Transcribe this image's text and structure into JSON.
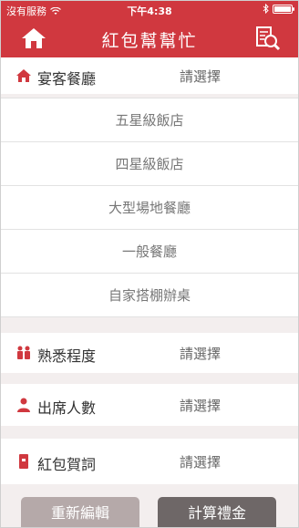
{
  "status": {
    "carrier": "沒有服務",
    "time": "下午4:38"
  },
  "nav": {
    "title": "紅包幫幫忙"
  },
  "venue": {
    "label": "宴客餐廳",
    "value": "請選擇",
    "options": [
      "五星級飯店",
      "四星級飯店",
      "大型場地餐廳",
      "一般餐廳",
      "自家搭棚辦桌"
    ]
  },
  "familiarity": {
    "label": "熟悉程度",
    "value": "請選擇"
  },
  "attendees": {
    "label": "出席人數",
    "value": "請選擇"
  },
  "greeting": {
    "label": "紅包賀詞",
    "value": "請選擇"
  },
  "actions": {
    "reset_label": "重新編輯",
    "calc_label": "計算禮金"
  },
  "colors": {
    "brand": "#d0383f",
    "reset_button": "#b5a9a9",
    "calc_button": "#6e6767"
  }
}
